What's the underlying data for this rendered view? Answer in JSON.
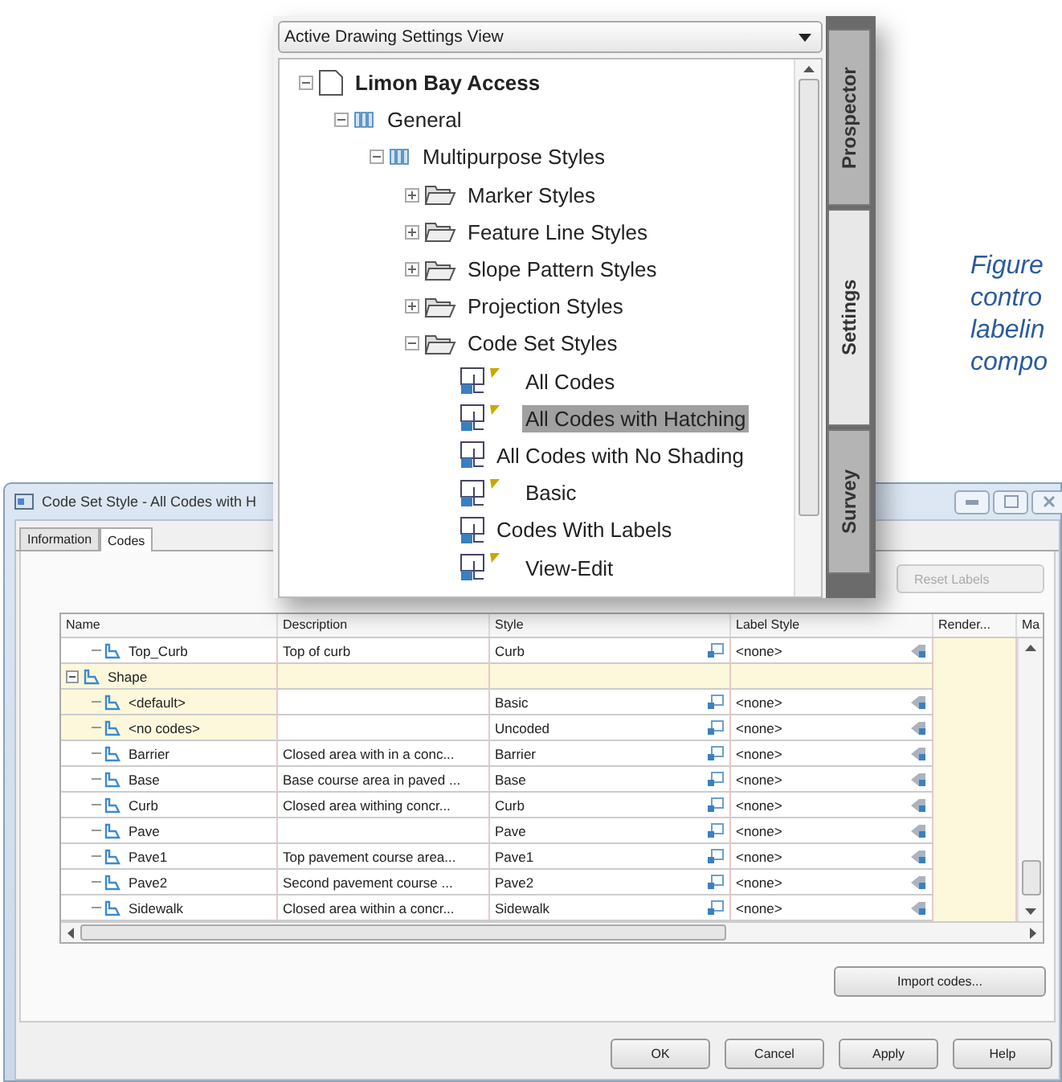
{
  "dialog": {
    "title": "Code Set Style - All Codes with H",
    "tabs": [
      {
        "label": "Information",
        "selected": false
      },
      {
        "label": "Codes",
        "selected": true
      }
    ],
    "reset_button": {
      "label": "Reset Labels",
      "disabled": true
    },
    "table": {
      "columns": [
        "Name",
        "Description",
        "Style",
        "Label Style",
        "Render...",
        "Ma"
      ],
      "rows": [
        {
          "kind": "code",
          "name": "Top_Curb",
          "description": "Top of curb",
          "style": "Curb",
          "label_style": "<none>",
          "shaded": false
        },
        {
          "kind": "group",
          "name": "Shape",
          "expanded": true,
          "shaded": true
        },
        {
          "kind": "code",
          "name": "<default>",
          "description": "",
          "style": "Basic",
          "label_style": "<none>",
          "shaded": true
        },
        {
          "kind": "code",
          "name": "<no codes>",
          "description": "",
          "style": "Uncoded",
          "label_style": "<none>",
          "shaded": true
        },
        {
          "kind": "code",
          "name": "Barrier",
          "description": "Closed area with in a conc...",
          "style": "Barrier",
          "label_style": "<none>",
          "shaded": false
        },
        {
          "kind": "code",
          "name": "Base",
          "description": "Base course area in paved ...",
          "style": "Base",
          "label_style": "<none>",
          "shaded": false
        },
        {
          "kind": "code",
          "name": "Curb",
          "description": "Closed area withing concr...",
          "style": "Curb",
          "label_style": "<none>",
          "shaded": false
        },
        {
          "kind": "code",
          "name": "Pave",
          "description": "",
          "style": "Pave",
          "label_style": "<none>",
          "shaded": false
        },
        {
          "kind": "code",
          "name": "Pave1",
          "description": "Top pavement course area...",
          "style": "Pave1",
          "label_style": "<none>",
          "shaded": false
        },
        {
          "kind": "code",
          "name": "Pave2",
          "description": "Second pavement course ...",
          "style": "Pave2",
          "label_style": "<none>",
          "shaded": false
        },
        {
          "kind": "code",
          "name": "Sidewalk",
          "description": "Closed area within a concr...",
          "style": "Sidewalk",
          "label_style": "<none>",
          "shaded": false
        }
      ]
    },
    "import_button": "Import codes...",
    "buttons": [
      "OK",
      "Cancel",
      "Apply",
      "Help"
    ]
  },
  "toolspace": {
    "view_dropdown": "Active Drawing Settings View",
    "tree": [
      {
        "label": "Limon Bay Access",
        "kind": "drawing",
        "expanded": true,
        "selected": false,
        "children": [
          {
            "label": "General",
            "kind": "style-group",
            "expanded": true,
            "selected": false,
            "children": [
              {
                "label": "Multipurpose Styles",
                "kind": "style-group",
                "expanded": true,
                "selected": false,
                "children": [
                  {
                    "label": "Marker Styles",
                    "kind": "folder",
                    "expanded": false,
                    "selected": false
                  },
                  {
                    "label": "Feature Line Styles",
                    "kind": "folder",
                    "expanded": false,
                    "selected": false
                  },
                  {
                    "label": "Slope Pattern Styles",
                    "kind": "folder",
                    "expanded": false,
                    "selected": false
                  },
                  {
                    "label": "Projection Styles",
                    "kind": "folder",
                    "expanded": false,
                    "selected": false
                  },
                  {
                    "label": "Code Set Styles",
                    "kind": "folder",
                    "expanded": true,
                    "selected": false,
                    "children": [
                      {
                        "label": "All Codes",
                        "kind": "code-set",
                        "flag": true,
                        "selected": false
                      },
                      {
                        "label": "All Codes with Hatching",
                        "kind": "code-set",
                        "flag": true,
                        "selected": true
                      },
                      {
                        "label": "All Codes with No Shading",
                        "kind": "code-set",
                        "flag": false,
                        "selected": false
                      },
                      {
                        "label": "Basic",
                        "kind": "code-set",
                        "flag": true,
                        "selected": false
                      },
                      {
                        "label": "Codes With Labels",
                        "kind": "code-set",
                        "flag": false,
                        "selected": false
                      },
                      {
                        "label": "View-Edit",
                        "kind": "code-set",
                        "flag": true,
                        "selected": false
                      }
                    ]
                  }
                ]
              }
            ]
          }
        ]
      }
    ],
    "side_tabs": [
      {
        "label": "Prospector",
        "selected": false
      },
      {
        "label": "Settings",
        "selected": true
      },
      {
        "label": "Survey",
        "selected": false
      }
    ]
  },
  "caption": [
    "Figure",
    "contro",
    "labelin",
    "compo"
  ]
}
